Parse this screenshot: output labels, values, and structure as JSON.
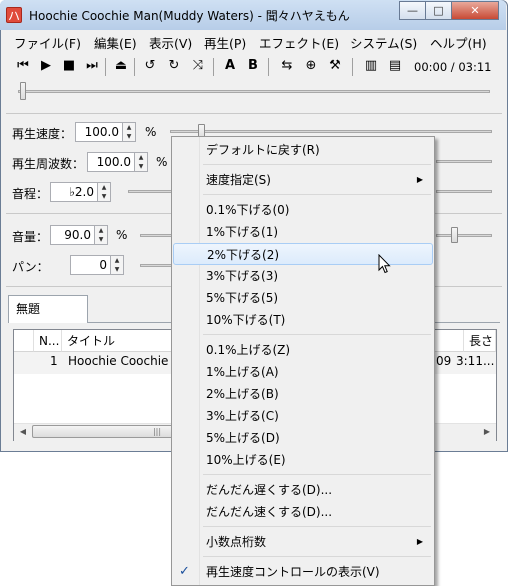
{
  "window": {
    "title": "Hoochie Coochie Man(Muddy Waters) - 聞々ハヤえもん",
    "app_icon": "ハ",
    "controls": [
      "—",
      "□",
      "✕"
    ]
  },
  "menubar": [
    "ファイル(F)",
    "編集(E)",
    "表示(V)",
    "再生(P)",
    "エフェクト(E)",
    "システム(S)",
    "ヘルプ(H)"
  ],
  "toolbar": {
    "icons": [
      "prev-icon",
      "play-icon",
      "stop-icon",
      "next-icon",
      "eject-icon",
      "repeat-one-icon",
      "repeat-all-icon",
      "random-icon",
      "marker-a-icon",
      "marker-b-icon",
      "loop-icon",
      "position-icon",
      "tuning-icon",
      "view-list-icon",
      "view-compact-icon"
    ],
    "a_label": "A",
    "b_label": "B",
    "time": "00:00 / 03:11"
  },
  "controls": {
    "speed": {
      "label": "再生速度：",
      "value": "100.0",
      "unit": "%"
    },
    "frequency": {
      "label": "再生周波数：",
      "value": "100.0",
      "unit": "%"
    },
    "pitch": {
      "label": "音程：",
      "value": "♭2.0"
    },
    "volume": {
      "label": "音量：",
      "value": "90.0",
      "unit": "%"
    },
    "pan": {
      "label": "パン：",
      "value": "0"
    }
  },
  "playlist": {
    "tab": "無題",
    "headers": [
      "N...",
      "タイトル",
      "",
      "長さ"
    ],
    "rows": [
      {
        "n": "1",
        "title": "Hoochie Coochie M",
        "extra": "09",
        "length": "3:11..."
      }
    ]
  },
  "context_menu": {
    "items": [
      {
        "label": "デフォルトに戻す(R)"
      },
      {
        "label": "速度指定(S)",
        "submenu": true
      },
      {
        "label": "0.1%下げる(0)"
      },
      {
        "label": "1%下げる(1)"
      },
      {
        "label": "2%下げる(2)",
        "highlighted": true
      },
      {
        "label": "3%下げる(3)"
      },
      {
        "label": "5%下げる(5)"
      },
      {
        "label": "10%下げる(T)"
      },
      {
        "label": "0.1%上げる(Z)"
      },
      {
        "label": "1%上げる(A)"
      },
      {
        "label": "2%上げる(B)"
      },
      {
        "label": "3%上げる(C)"
      },
      {
        "label": "5%上げる(D)"
      },
      {
        "label": "10%上げる(E)"
      },
      {
        "label": "だんだん遅くする(D)..."
      },
      {
        "label": "だんだん速くする(D)..."
      },
      {
        "label": "小数点桁数",
        "submenu": true
      },
      {
        "label": "再生速度コントロールの表示(V)",
        "checked": true
      }
    ]
  },
  "colors": {
    "titlebar": "#b7cde8",
    "highlight": "#dcebfc",
    "close_button": "#c84a35",
    "checkmark": "#1a4f9c"
  }
}
